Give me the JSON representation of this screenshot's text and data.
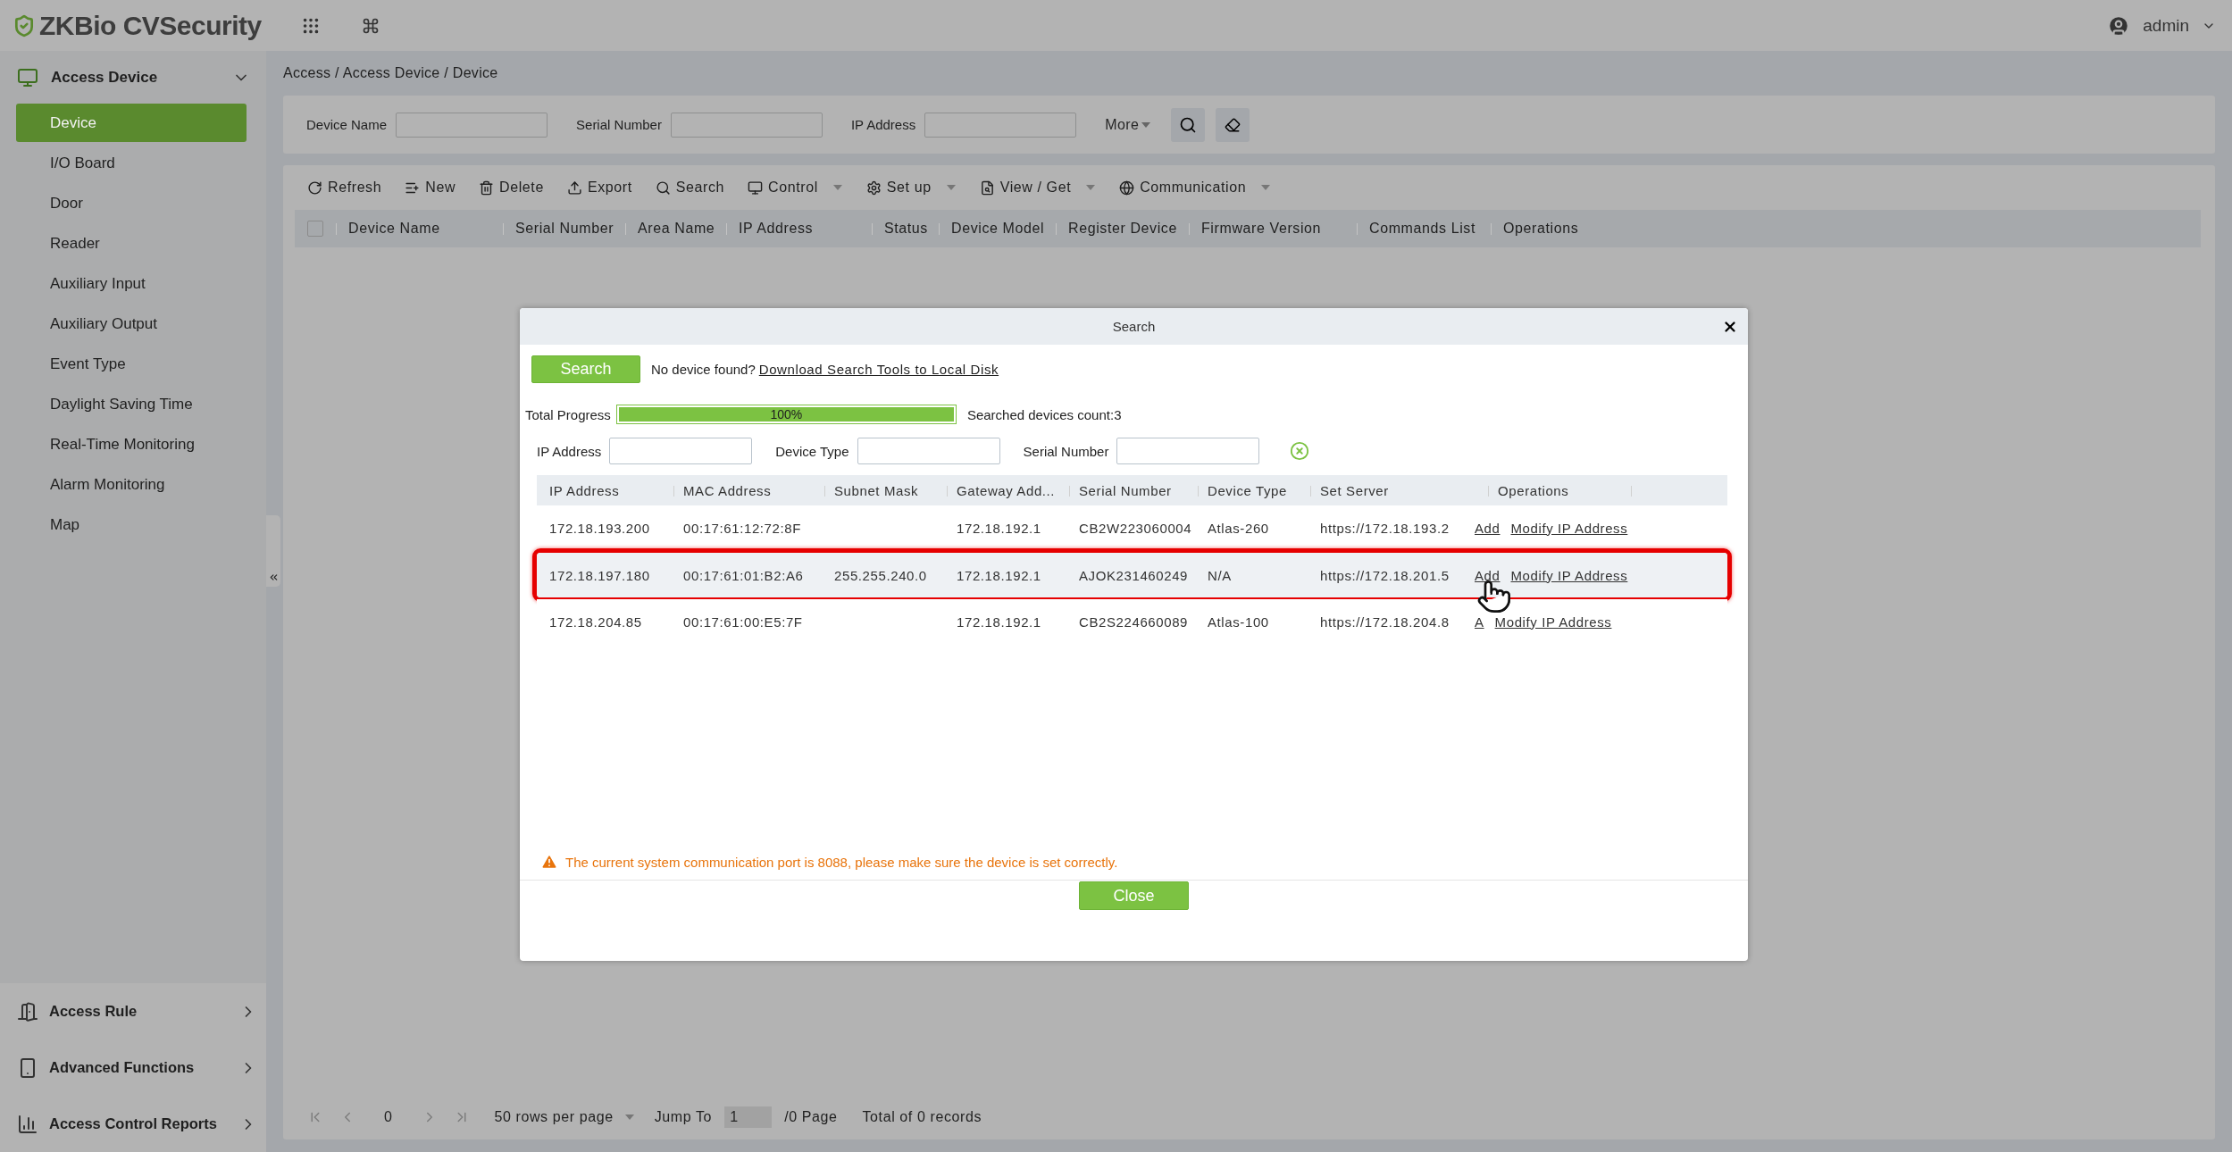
{
  "header": {
    "logo": "ZKBio CVSecurity",
    "user": "admin"
  },
  "sidebar": {
    "group": {
      "label": "Access Device",
      "expanded": true
    },
    "items": [
      {
        "label": "Device",
        "selected": true
      },
      {
        "label": "I/O Board",
        "selected": false
      },
      {
        "label": "Door",
        "selected": false
      },
      {
        "label": "Reader",
        "selected": false
      },
      {
        "label": "Auxiliary Input",
        "selected": false
      },
      {
        "label": "Auxiliary Output",
        "selected": false
      },
      {
        "label": "Event Type",
        "selected": false
      },
      {
        "label": "Daylight Saving Time",
        "selected": false
      },
      {
        "label": "Real-Time Monitoring",
        "selected": false
      },
      {
        "label": "Alarm Monitoring",
        "selected": false
      },
      {
        "label": "Map",
        "selected": false
      }
    ],
    "sections": [
      {
        "label": "Access Rule"
      },
      {
        "label": "Advanced Functions"
      },
      {
        "label": "Access Control Reports"
      }
    ]
  },
  "breadcrumb": "Access / Access Device / Device",
  "filters": [
    {
      "label": "Device Name"
    },
    {
      "label": "Serial Number"
    },
    {
      "label": "IP Address"
    }
  ],
  "more": "More",
  "toolbar": [
    {
      "label": "Refresh",
      "dropdown": false
    },
    {
      "label": "New",
      "dropdown": false
    },
    {
      "label": "Delete",
      "dropdown": false
    },
    {
      "label": "Export",
      "dropdown": false
    },
    {
      "label": "Search",
      "dropdown": false
    },
    {
      "label": "Control",
      "dropdown": true
    },
    {
      "label": "Set up",
      "dropdown": true
    },
    {
      "label": "View / Get",
      "dropdown": true
    },
    {
      "label": "Communication",
      "dropdown": true
    }
  ],
  "table": {
    "select_all": {
      "checked": false
    },
    "columns": [
      "Device Name",
      "Serial Number",
      "Area Name",
      "IP Address",
      "Status",
      "Device Model",
      "Register Device",
      "Firmware Version",
      "Commands List",
      "Operations"
    ]
  },
  "pagination": {
    "page": "0",
    "rows_per_page": "50 rows per page",
    "jump_label": "Jump To",
    "jump_value": "1",
    "pages": "/0 Page",
    "total": "Total of 0 records"
  },
  "dialog": {
    "title": "Search",
    "search_button": "Search",
    "notice": "No device found?",
    "download_link": "Download Search Tools to Local Disk",
    "progress": {
      "label": "Total Progress",
      "level": 1,
      "text": "100%"
    },
    "count": "Searched devices count:3",
    "filters": [
      {
        "label": "IP Address"
      },
      {
        "label": "Device Type"
      },
      {
        "label": "Serial Number"
      }
    ],
    "columns": [
      "IP Address",
      "MAC Address",
      "Subnet Mask",
      "Gateway Add...",
      "Serial Number",
      "Device Type",
      "Set Server",
      "Operations"
    ],
    "rows": [
      {
        "cells": [
          "172.18.193.200",
          "00:17:61:12:72:8F",
          "",
          "172.18.192.1",
          "CB2W223060004",
          "Atlas-260",
          "https://172.18.193.2"
        ],
        "add": "Add",
        "modify": "Modify IP Address",
        "highlighted": false
      },
      {
        "cells": [
          "172.18.197.180",
          "00:17:61:01:B2:A6",
          "255.255.240.0",
          "172.18.192.1",
          "AJOK231460249",
          "N/A",
          "https://172.18.201.5"
        ],
        "add": "Add",
        "modify": "Modify IP Address",
        "highlighted": true
      },
      {
        "cells": [
          "172.18.204.85",
          "00:17:61:00:E5:7F",
          "",
          "172.18.192.1",
          "CB2S224660089",
          "Atlas-100",
          "https://172.18.204.8"
        ],
        "add": "A",
        "modify": "Modify IP Address",
        "highlighted": false
      }
    ],
    "warning": "The current system communication port is 8088, please make sure the device is set correctly.",
    "close_button": "Close"
  }
}
